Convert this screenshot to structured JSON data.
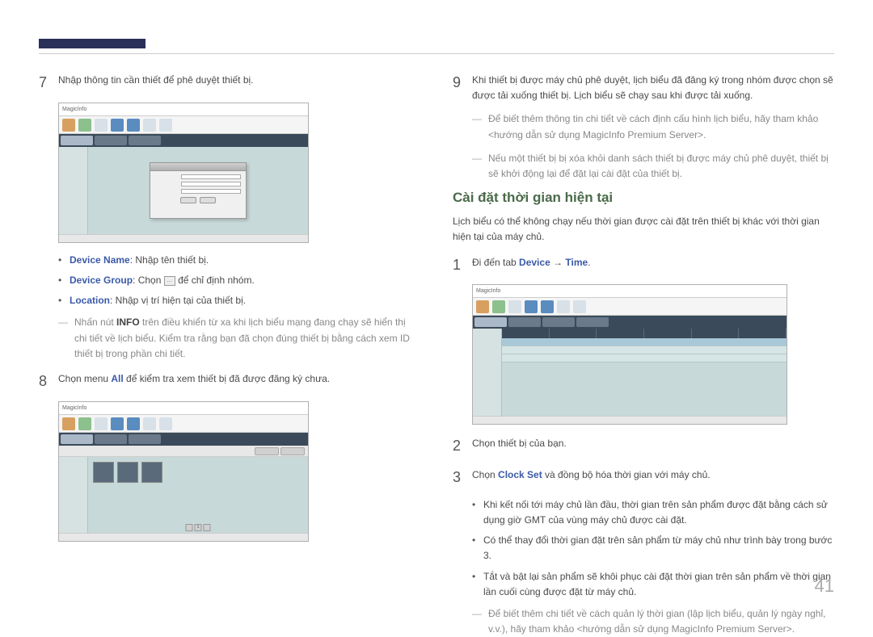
{
  "page_number": "41",
  "left": {
    "step7": "Nhập thông tin cần thiết để phê duyệt thiết bị.",
    "s7_bullets": [
      {
        "term": "Device Name",
        "rest": ": Nhập tên thiết bị."
      },
      {
        "term": "Device Group",
        "rest_a": ": Chọn ",
        "rest_b": " để chỉ định nhóm."
      },
      {
        "term": "Location",
        "rest": ": Nhập vị trí hiện tại của thiết bị."
      }
    ],
    "s7_note_a": "Nhấn nút ",
    "s7_note_info": "INFO",
    "s7_note_b": " trên điều khiển từ xa khi lịch biểu mạng đang chạy sẽ hiển thị chi tiết về lịch biểu. Kiểm tra rằng bạn đã chọn đúng thiết bị bằng cách xem ID thiết bị trong phần chi tiết.",
    "step8_a": "Chọn menu ",
    "step8_all": "All",
    "step8_b": " để kiểm tra xem thiết bị đã được đăng ký chưa.",
    "shot_logo": "MagicInfo"
  },
  "right": {
    "step9": "Khi thiết bị được máy chủ phê duyệt, lịch biểu đã đăng ký trong nhóm được chọn sẽ được tải xuống thiết bị. Lịch biểu sẽ chạy sau khi được tải xuống.",
    "s9_note1": "Để biết thêm thông tin chi tiết về cách định cấu hình lịch biểu, hãy tham khảo <hướng dẫn sử dụng MagicInfo Premium Server>.",
    "s9_note2": "Nếu một thiết bị bị xóa khỏi danh sách thiết bị được máy chủ phê duyệt, thiết bị sẽ khởi động lại để đặt lại cài đặt của thiết bị.",
    "heading": "Cài đặt thời gian hiện tại",
    "intro": "Lịch biểu có thể không chạy nếu thời gian được cài đặt trên thiết bị khác với thời gian hiện tại của máy chủ.",
    "step1_a": "Đi đến tab ",
    "step1_dev": "Device",
    "step1_arrow": " → ",
    "step1_time": "Time",
    "step1_dot": ".",
    "step2": "Chọn thiết bị của bạn.",
    "step3_a": "Chọn ",
    "step3_cs": "Clock Set",
    "step3_b": " và đồng bộ hóa thời gian với máy chủ.",
    "s3_bullets": [
      "Khi kết nối tới máy chủ lần đầu, thời gian trên sản phẩm được đặt bằng cách sử dụng giờ GMT của vùng máy chủ được cài đặt.",
      "Có thể thay đổi thời gian đặt trên sản phẩm từ máy chủ như trình bày trong bước 3.",
      "Tắt và bật lại sản phẩm sẽ khôi phục cài đặt thời gian trên sản phẩm về thời gian lần cuối cùng được đặt từ máy chủ."
    ],
    "s3_note": "Để biết thêm chi tiết về cách quản lý thời gian (lập lịch biểu, quản lý ngày nghỉ, v.v.), hãy tham khảo <hướng dẫn sử dụng MagicInfo Premium Server>."
  }
}
